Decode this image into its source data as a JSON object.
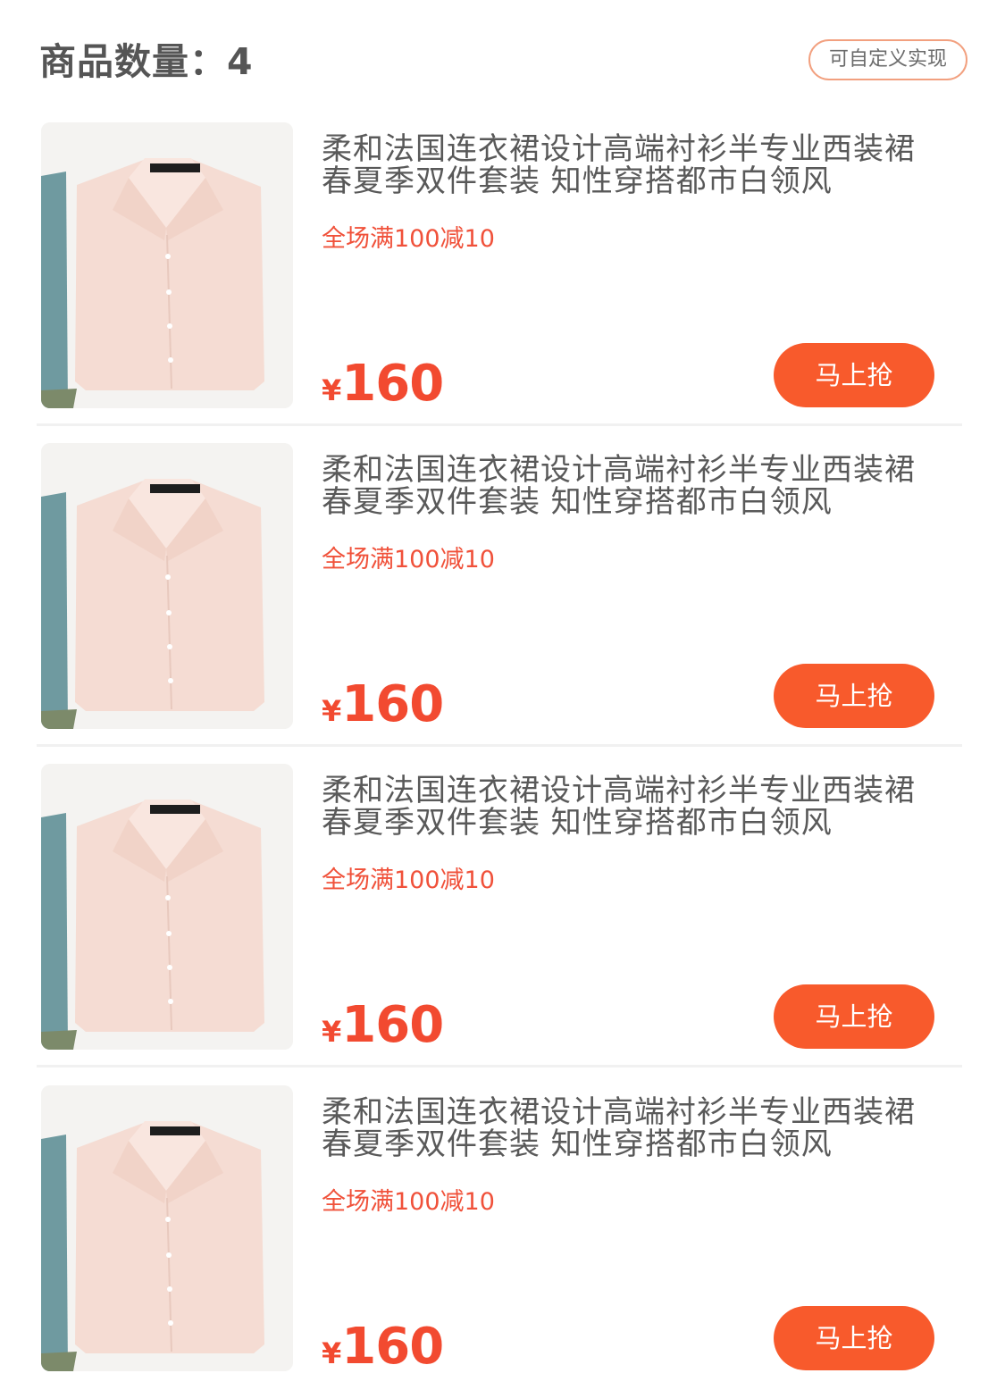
{
  "header": {
    "count_label": "商品数量：",
    "count_value": "4",
    "custom_button_label": "可自定义实现"
  },
  "products": [
    {
      "title": "柔和法国连衣裙设计高端衬衫半专业西装裙春夏季双件套装 知性穿搭都市白领风",
      "promo": "全场满100减10",
      "currency": "¥",
      "price": "160",
      "buy_label": "马上抢",
      "image": "pink-shirt-image"
    },
    {
      "title": "柔和法国连衣裙设计高端衬衫半专业西装裙春夏季双件套装 知性穿搭都市白领风",
      "promo": "全场满100减10",
      "currency": "¥",
      "price": "160",
      "buy_label": "马上抢",
      "image": "pink-shirt-image"
    },
    {
      "title": "柔和法国连衣裙设计高端衬衫半专业西装裙春夏季双件套装 知性穿搭都市白领风",
      "promo": "全场满100减10",
      "currency": "¥",
      "price": "160",
      "buy_label": "马上抢",
      "image": "pink-shirt-image"
    },
    {
      "title": "柔和法国连衣裙设计高端衬衫半专业西装裙春夏季双件套装 知性穿搭都市白领风",
      "promo": "全场满100减10",
      "currency": "¥",
      "price": "160",
      "buy_label": "马上抢",
      "image": "pink-shirt-image"
    }
  ],
  "colors": {
    "accent": "#f85a2c",
    "price": "#f24a30",
    "promo": "#f0513a",
    "title": "#595959",
    "custom_button_border": "#f2a07f"
  }
}
